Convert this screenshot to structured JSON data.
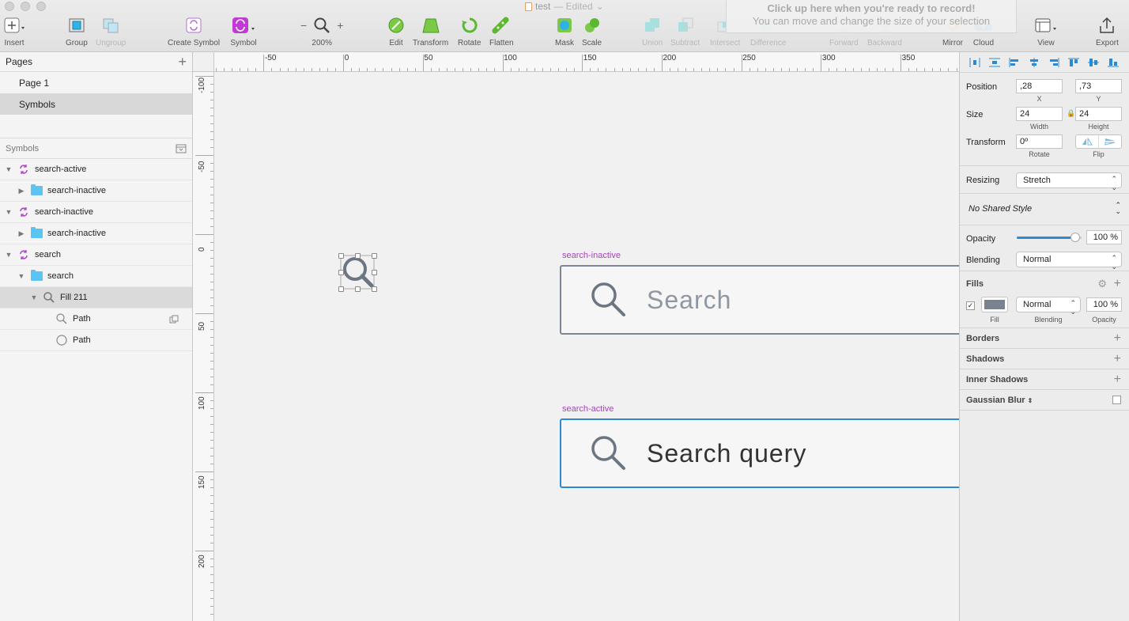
{
  "document": {
    "title": "test",
    "status": "— Edited"
  },
  "record_banner": {
    "title": "Click up here when you're ready to record!",
    "subtitle": "You can move and change the size of your selection"
  },
  "toolbar": {
    "insert": "Insert",
    "group": "Group",
    "ungroup": "Ungroup",
    "create_symbol": "Create Symbol",
    "symbol": "Symbol",
    "zoom_minus": "−",
    "zoom_plus": "+",
    "zoom_value": "200%",
    "edit": "Edit",
    "transform": "Transform",
    "rotate": "Rotate",
    "flatten": "Flatten",
    "mask": "Mask",
    "scale": "Scale",
    "union": "Union",
    "subtract": "Subtract",
    "intersect": "Intersect",
    "difference": "Difference",
    "forward": "Forward",
    "backward": "Backward",
    "mirror": "Mirror",
    "cloud": "Cloud",
    "view": "View",
    "export": "Export"
  },
  "sidebar": {
    "pages_title": "Pages",
    "add_icon": "+",
    "pages": [
      {
        "label": "Page 1"
      },
      {
        "label": "Symbols"
      }
    ],
    "symbols_title": "Symbols",
    "layers": [
      {
        "label": "search-active",
        "type": "symbol",
        "depth": 0,
        "arrow": "▼"
      },
      {
        "label": "search-inactive",
        "type": "folder",
        "depth": 1,
        "arrow": "▶"
      },
      {
        "label": "search-inactive",
        "type": "symbol",
        "depth": 0,
        "arrow": "▼"
      },
      {
        "label": "search-inactive",
        "type": "folder",
        "depth": 1,
        "arrow": "▶"
      },
      {
        "label": "search",
        "type": "symbol",
        "depth": 0,
        "arrow": "▼"
      },
      {
        "label": "search",
        "type": "folder",
        "depth": 1,
        "arrow": "▼"
      },
      {
        "label": "Fill 211",
        "type": "shape",
        "depth": 2,
        "arrow": "▼"
      },
      {
        "label": "Path",
        "type": "path-search",
        "depth": 3,
        "arrow": ""
      },
      {
        "label": "Path",
        "type": "path-circle",
        "depth": 3,
        "arrow": ""
      }
    ]
  },
  "canvas": {
    "ruler_top": [
      "-50",
      "0",
      "50",
      "100",
      "150",
      "200",
      "250",
      "300",
      "350"
    ],
    "ruler_left": [
      "-100",
      "-50",
      "0",
      "50",
      "100",
      "150",
      "200"
    ],
    "artboards": [
      {
        "label": "search-inactive",
        "text": "Search"
      },
      {
        "label": "search-active",
        "text": "Search query"
      }
    ],
    "colors": {
      "inactive_border": "#7b8794",
      "active_border": "#2a8ad4",
      "icon": "#6c7682"
    }
  },
  "inspector": {
    "position_label": "Position",
    "position_x": ",28",
    "position_y": ",73",
    "x_label": "X",
    "y_label": "Y",
    "size_label": "Size",
    "width": "24",
    "height": "24",
    "width_label": "Width",
    "height_label": "Height",
    "transform_label": "Transform",
    "rotate_value": "0º",
    "rotate_label": "Rotate",
    "flip_label": "Flip",
    "resizing_label": "Resizing",
    "resizing_value": "Stretch",
    "shared_style": "No Shared Style",
    "opacity_label": "Opacity",
    "opacity_value": "100 %",
    "opacity_fraction": 0.9,
    "blending_label": "Blending",
    "blending_value": "Normal",
    "fills_label": "Fills",
    "fill_color": "#78838f",
    "fill_label": "Fill",
    "fill_blending": "Normal",
    "fill_blending_label": "Blending",
    "fill_opacity": "100 %",
    "fill_opacity_label": "Opacity",
    "borders_label": "Borders",
    "shadows_label": "Shadows",
    "inner_shadows_label": "Inner Shadows",
    "blur_label": "Gaussian Blur"
  }
}
